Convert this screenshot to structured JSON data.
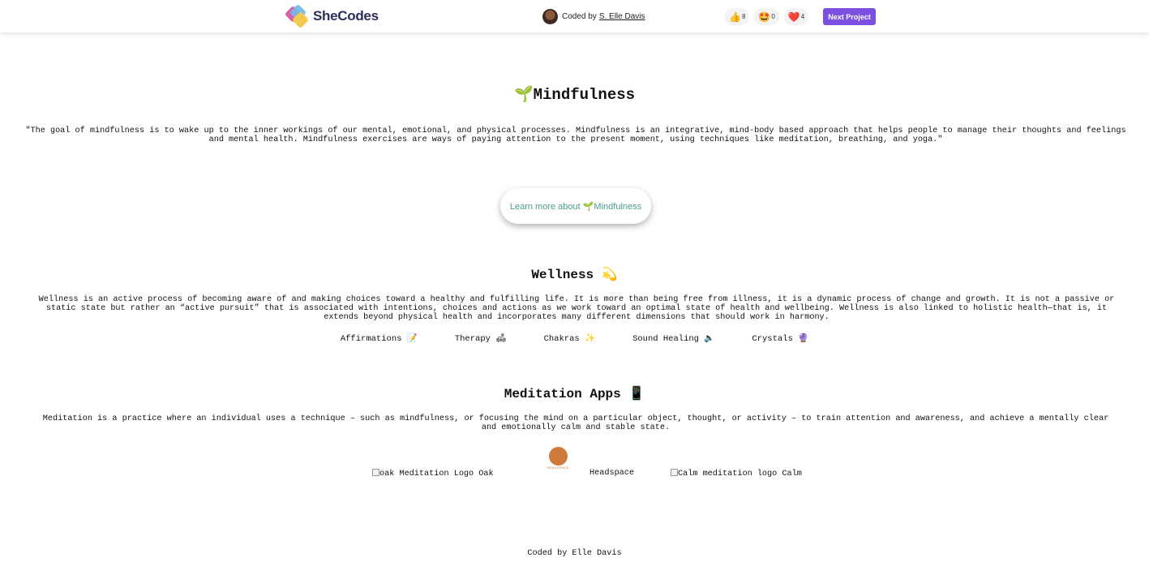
{
  "topbar": {
    "logo_text": "SheCodes",
    "coded_by_label": "Coded by",
    "coder_name": "S. Elle Davis",
    "reactions": [
      {
        "icon": "👍",
        "count": "8"
      },
      {
        "icon": "🤩",
        "count": "0"
      },
      {
        "icon": "❤️",
        "count": "4"
      }
    ],
    "next_button": "Next Project"
  },
  "mindfulness": {
    "title": "🌱Mindfulness",
    "quote": "\"The goal of mindfulness is to wake up to the inner workings of our mental, emotional, and physical processes. Mindfulness is an integrative, mind-body based approach that helps people to manage their thoughts and feelings and mental health. Mindfulness exercises are ways of paying attention to the present moment, using techniques like meditation, breathing, and yoga.\"",
    "learn_button": "Learn more about 🌱Mindfulness"
  },
  "wellness": {
    "title": "Wellness 💫",
    "text": "Wellness is an active process of becoming aware of and making choices toward a healthy and fulfilling life. It is more than being free from illness, it is a dynamic process of change and growth. It is not a passive or static state but rather an “active pursuit” that is associated with intentions, choices and actions as we work toward an optimal state of health and wellbeing. Wellness is also linked to holistic health—that is, it extends beyond physical health and incorporates many different dimensions that should work in harmony.",
    "links": [
      "Affirmations 📝",
      "Therapy 🛋",
      "Chakras ✨",
      "Sound Healing 🔈",
      "Crystals 🔮"
    ]
  },
  "meditation": {
    "title": "Meditation Apps 📱",
    "text": "Meditation is a practice where an individual uses a technique – such as mindfulness, or focusing the mind on a particular object, thought, or activity – to train attention and awareness, and achieve a mentally clear and emotionally calm and stable state.",
    "apps": {
      "oak_alt": "oak Meditation Logo",
      "oak_name": "Oak",
      "headspace_logo_text": "HEADSPACE",
      "headspace_name": "Headspace",
      "calm_alt": "Calm meditation logo",
      "calm_name": "Calm"
    }
  },
  "footer": {
    "text": "Coded by Elle Davis"
  }
}
